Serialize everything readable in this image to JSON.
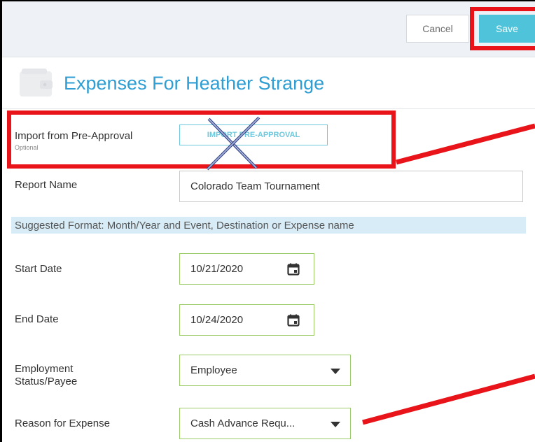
{
  "toolbar": {
    "cancel_label": "Cancel",
    "save_label": "Save"
  },
  "header": {
    "title": "Expenses For Heather Strange",
    "icon": "wallet-icon"
  },
  "form": {
    "import": {
      "label": "Import from Pre-Approval",
      "sub_label": "Optional",
      "button_label": "IMPORT PRE-APPROVAL"
    },
    "report_name": {
      "label": "Report Name",
      "value": "Colorado Team Tournament"
    },
    "hint": "Suggested Format: Month/Year and Event, Destination or Expense name",
    "start_date": {
      "label": "Start Date",
      "value": "10/21/2020"
    },
    "end_date": {
      "label": "End Date",
      "value": "10/24/2020"
    },
    "employment": {
      "label_line1": "Employment",
      "label_line2": "Status/Payee",
      "value": "Employee"
    },
    "reason": {
      "label": "Reason for Expense",
      "value": "Cash Advance Requ..."
    }
  },
  "colors": {
    "accent": "#2f9ed3",
    "save_button": "#4fc3d9",
    "annotation_red": "#e8141a",
    "field_border_green": "#9ccb6a",
    "hint_background": "#d8ecf7"
  }
}
